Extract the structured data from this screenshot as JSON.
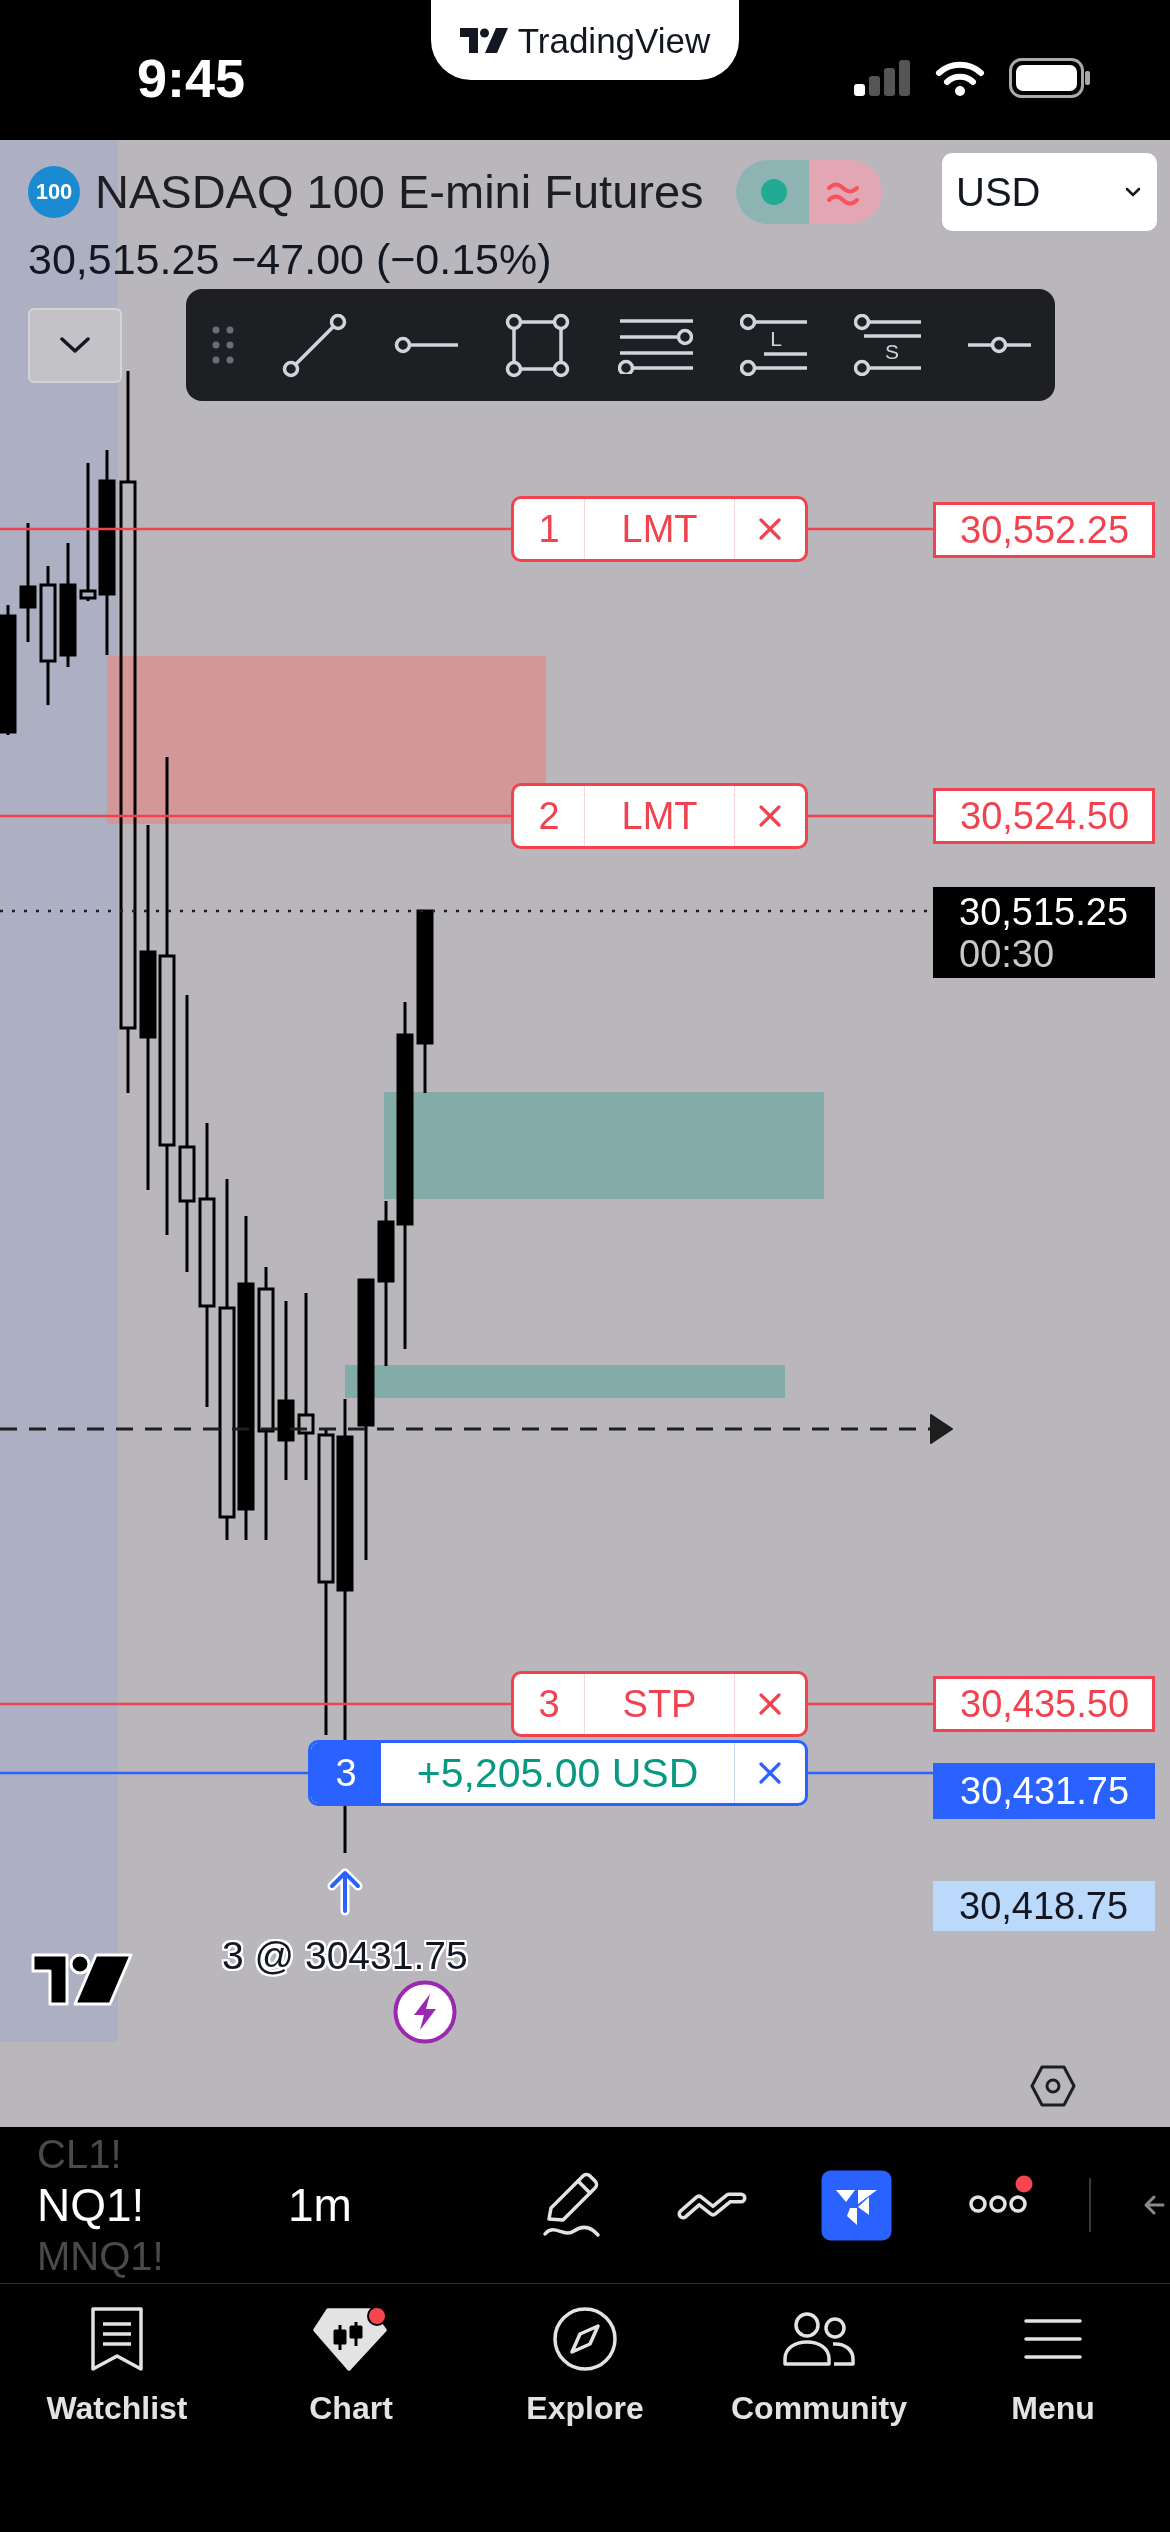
{
  "status_bar": {
    "time": "9:45",
    "app_name": "TradingView"
  },
  "symbol": {
    "logo": "100",
    "name": "NASDAQ 100 E-mini Futures",
    "quote": "30,515.25 −47.00 (−0.15%)"
  },
  "currency": {
    "value": "USD"
  },
  "drawing_toolbar": {
    "long_label": "L",
    "short_label": "S"
  },
  "orders": [
    {
      "kind": "order",
      "number": "1",
      "type": "LMT",
      "price": "30,552.25"
    },
    {
      "kind": "order",
      "number": "2",
      "type": "LMT",
      "price": "30,524.50"
    },
    {
      "kind": "order",
      "number": "3",
      "type": "STP",
      "price": "30,435.50"
    },
    {
      "kind": "position",
      "number": "3",
      "pnl": "+5,205.00 USD",
      "price": "30,431.75"
    }
  ],
  "last_price": {
    "price": "30,515.25",
    "countdown": "00:30"
  },
  "price_marker": {
    "price": "30,418.75"
  },
  "execution": {
    "label": "3 @ 30431.75"
  },
  "bottom_toolbar": {
    "symbols": [
      {
        "label": "CL1!",
        "selected": false
      },
      {
        "label": "NQ1!",
        "selected": true
      },
      {
        "label": "MNQ1!",
        "selected": false
      }
    ],
    "interval": "1m",
    "panel_active": true,
    "more_badge": true
  },
  "tabs": [
    {
      "label": "Watchlist",
      "selected": false,
      "badge": false
    },
    {
      "label": "Chart",
      "selected": true,
      "badge": true
    },
    {
      "label": "Explore",
      "selected": false,
      "badge": false
    },
    {
      "label": "Community",
      "selected": false,
      "badge": false
    },
    {
      "label": "Menu",
      "selected": false,
      "badge": false
    }
  ]
}
